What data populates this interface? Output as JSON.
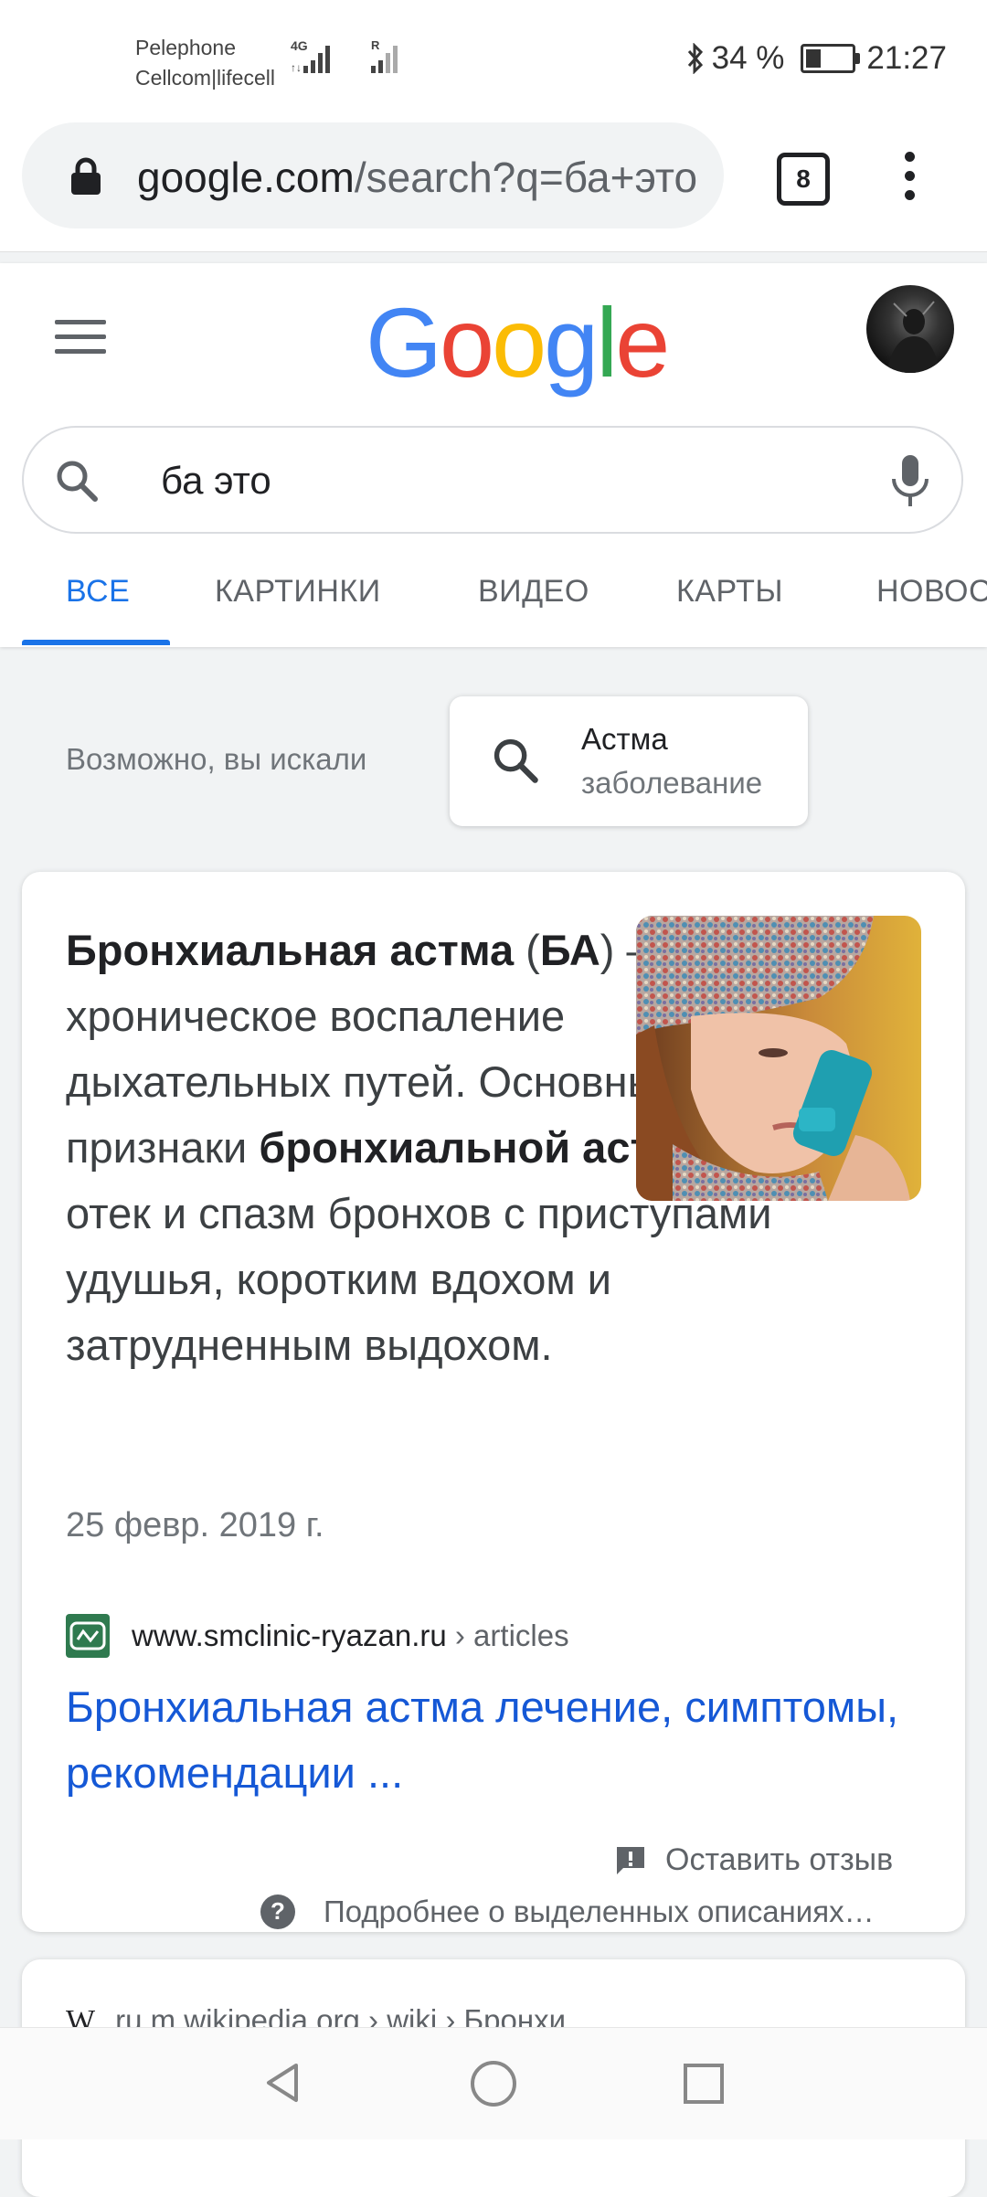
{
  "status_bar": {
    "carrier1": "Pelephone",
    "carrier2": "Cellcom|lifecell",
    "net1": "4G",
    "net2": "R",
    "battery_pct": "34 %",
    "battery_level": 0.34,
    "time": "21:27"
  },
  "browser": {
    "url_domain": "google.com",
    "url_rest": "/search?q=ба+это",
    "tab_count": "8"
  },
  "google": {
    "logo_letters": [
      "G",
      "o",
      "o",
      "g",
      "l",
      "e"
    ],
    "logo_colors": [
      "#4285F4",
      "#EA4335",
      "#FBBC05",
      "#4285F4",
      "#34A853",
      "#EA4335"
    ],
    "query": "ба это",
    "tabs": [
      "ВСЕ",
      "КАРТИНКИ",
      "ВИДЕО",
      "КАРТЫ",
      "НОВОСТИ"
    ],
    "active_tab": "ВСЕ"
  },
  "did_you_mean": {
    "label": "Возможно, вы искали",
    "chip_title": "Астма",
    "chip_subtitle": "заболевание"
  },
  "featured_snippet": {
    "b1": "Бронхиальная астма",
    "t1": " (",
    "b2": "БА",
    "t2": ") — хроническое воспаление дыхательных путей. Основные признаки ",
    "b3": "бронхиальной астмы",
    "t3": " — отек и спазм бронхов с приступами удушья, коротким вдохом и затрудненным выдохом.",
    "date": "25 февр. 2019 г.",
    "site_domain": "www.smclinic-ryazan.ru",
    "site_path": " › articles",
    "title": "Бронхиальная астма лечение, симптомы, рекомендации ...",
    "feedback": "Оставить отзыв",
    "learn_more": "Подробнее о выделенных описаниях…"
  },
  "next_result": {
    "url": "ru.m.wikipedia.org › wiki › Бронхи..."
  },
  "icons": {
    "lock": "lock-icon",
    "search": "search-icon",
    "mic": "mic-icon",
    "menu": "menu-icon",
    "more": "more-vert-icon",
    "feedback": "feedback-icon",
    "help": "help-icon",
    "back": "nav-back-icon",
    "home": "nav-home-icon",
    "recents": "nav-recents-icon"
  }
}
